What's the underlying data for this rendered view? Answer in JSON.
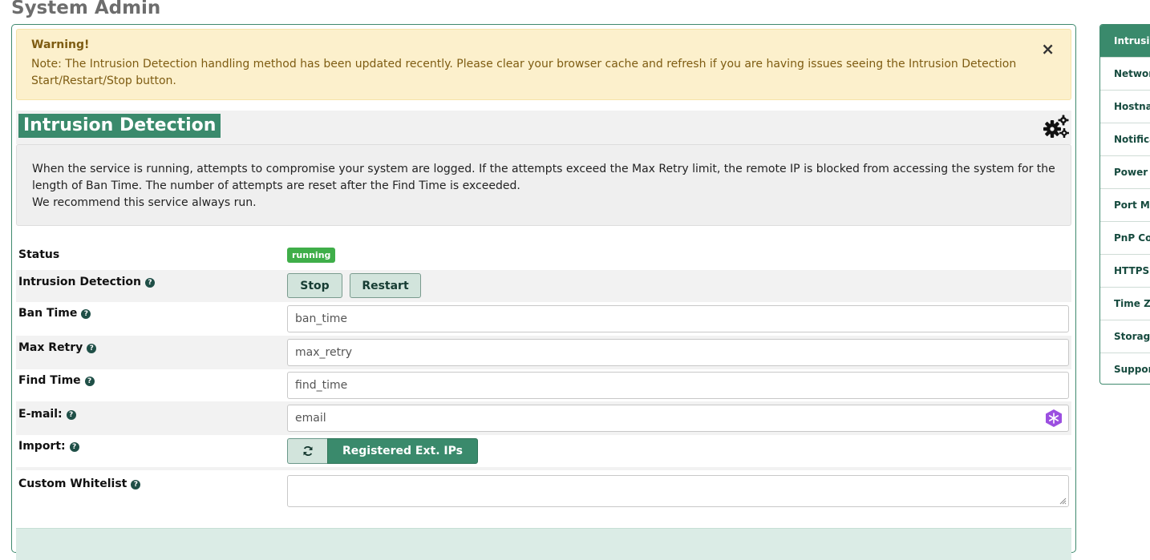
{
  "page": {
    "title": "System Admin"
  },
  "alert": {
    "title": "Warning!",
    "text": "Note: The Intrusion Detection handling method has been updated recently. Please clear your browser cache and refresh if you are having issues seeing the Intrusion Detection Start/Restart/Stop button.",
    "close": "×"
  },
  "section": {
    "title": "Intrusion Detection",
    "description": [
      "When the service is running, attempts to compromise your system are logged. If the attempts exceed the Max Retry limit, the remote IP is blocked from accessing the system for the length of Ban Time. The number of attempts are reset after the Find Time is exceeded.",
      "We recommend this service always run."
    ]
  },
  "form": {
    "status_label": "Status",
    "status_value": "running",
    "status_color": "#3fae49",
    "ids_label": "Intrusion Detection",
    "stop_label": "Stop",
    "restart_label": "Restart",
    "ban_time_label": "Ban Time",
    "ban_time_placeholder": "ban_time",
    "max_retry_label": "Max Retry",
    "max_retry_placeholder": "max_retry",
    "find_time_label": "Find Time",
    "find_time_placeholder": "find_time",
    "email_label": "E-mail:",
    "email_placeholder": "email",
    "import_label": "Import:",
    "import_button": "Registered Ext. IPs",
    "whitelist_label": "Custom Whitelist"
  },
  "sidebar": {
    "items": [
      {
        "label": "Intrusion Detection",
        "active": true
      },
      {
        "label": "Network"
      },
      {
        "label": "Hostname"
      },
      {
        "label": "Notifications"
      },
      {
        "label": "Power Options"
      },
      {
        "label": "Port Management"
      },
      {
        "label": "PnP Configuration"
      },
      {
        "label": "HTTPS Settings"
      },
      {
        "label": "Time Zone"
      },
      {
        "label": "Storage"
      },
      {
        "label": "Support"
      }
    ]
  },
  "colors": {
    "accent": "#3a8a6c",
    "warning_bg": "#fcf0cc",
    "warning_text": "#7e5c12"
  },
  "icons": [
    "gear-icon",
    "help-icon",
    "refresh-icon",
    "close-icon",
    "password-manager-icon",
    "resize-grip-icon"
  ]
}
